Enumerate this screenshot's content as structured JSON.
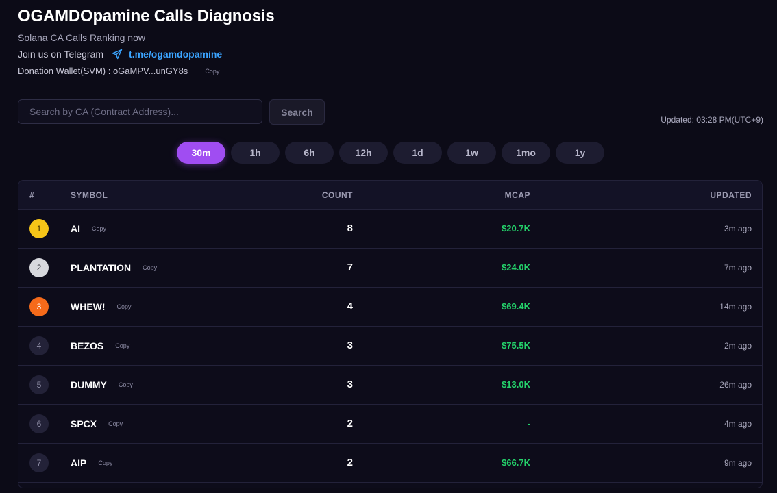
{
  "header": {
    "title": "OGAMDOpamine Calls Diagnosis",
    "subtitle": "Solana CA Calls Ranking now",
    "telegram_label": "Join us on Telegram",
    "telegram_link": "t.me/ogamdopamine",
    "wallet_text": "Donation Wallet(SVM) : oGaMPV...unGY8s",
    "copy_label": "Copy"
  },
  "search": {
    "placeholder": "Search by CA (Contract Address)...",
    "button_label": "Search"
  },
  "updated_label": "Updated: 03:28 PM(UTC+9)",
  "tabs": [
    {
      "label": "30m"
    },
    {
      "label": "1h"
    },
    {
      "label": "6h"
    },
    {
      "label": "12h"
    },
    {
      "label": "1d"
    },
    {
      "label": "1w"
    },
    {
      "label": "1mo"
    },
    {
      "label": "1y"
    }
  ],
  "active_tab": "30m",
  "table": {
    "headers": {
      "rank": "#",
      "symbol": "SYMBOL",
      "count": "COUNT",
      "mcap": "MCAP",
      "updated": "UPDATED"
    },
    "rows": [
      {
        "rank": "1",
        "symbol": "AI",
        "copy": "Copy",
        "count": "8",
        "mcap": "$20.7K",
        "updated": "3m ago"
      },
      {
        "rank": "2",
        "symbol": "PLANTATION",
        "copy": "Copy",
        "count": "7",
        "mcap": "$24.0K",
        "updated": "7m ago"
      },
      {
        "rank": "3",
        "symbol": "WHEW!",
        "copy": "Copy",
        "count": "4",
        "mcap": "$69.4K",
        "updated": "14m ago"
      },
      {
        "rank": "4",
        "symbol": "BEZOS",
        "copy": "Copy",
        "count": "3",
        "mcap": "$75.5K",
        "updated": "2m ago"
      },
      {
        "rank": "5",
        "symbol": "DUMMY",
        "copy": "Copy",
        "count": "3",
        "mcap": "$13.0K",
        "updated": "26m ago"
      },
      {
        "rank": "6",
        "symbol": "SPCX",
        "copy": "Copy",
        "count": "2",
        "mcap": "-",
        "updated": "4m ago"
      },
      {
        "rank": "7",
        "symbol": "AIP",
        "copy": "Copy",
        "count": "2",
        "mcap": "$66.7K",
        "updated": "9m ago"
      }
    ]
  },
  "colors": {
    "accent": "#a04df2",
    "link": "#3ba4ff",
    "mcap": "#24d36b",
    "rank1": "#f5c518",
    "rank2": "#d7d8dd",
    "rank3": "#f56a1a"
  },
  "icons": {
    "telegram": "send-paper-plane-icon"
  }
}
